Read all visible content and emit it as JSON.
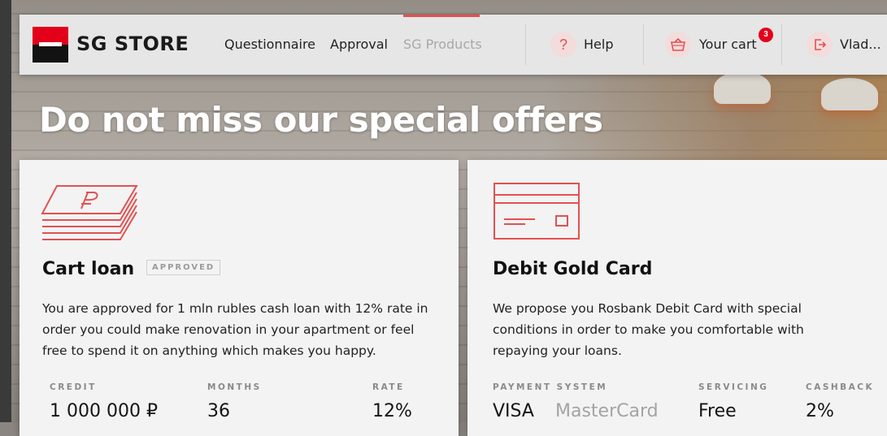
{
  "header": {
    "brand": "SG STORE",
    "nav": [
      "Questionnaire",
      "Approval",
      "SG Products"
    ],
    "active_nav": "SG Products",
    "help_label": "Help",
    "cart_label": "Your cart",
    "cart_count": "3",
    "user_label": "Vlad...",
    "accent_color": "#e35050",
    "brand_red": "#e3001b"
  },
  "headline": "Do not miss our special offers",
  "offers": [
    {
      "icon": "cash-stack-icon",
      "title": "Cart loan",
      "status": "APPROVED",
      "description_lines": [
        "You are approved for 1 mln rubles cash loan with 12% rate in",
        "order you could make renovation in your apartment or feel",
        "free to spend it on anything which makes you happy."
      ],
      "stats": [
        {
          "label": "CREDIT",
          "value": "1 000 000 ₽"
        },
        {
          "label": "MONTHS",
          "value": "36"
        },
        {
          "label": "RATE",
          "value": "12%"
        }
      ]
    },
    {
      "icon": "bank-card-icon",
      "title": "Debit Gold Card",
      "description_lines": [
        "We propose you Rosbank Debit Card with special",
        "conditions in order to make you comfortable with",
        "repaying your loans."
      ],
      "stats": [
        {
          "label": "PAYMENT SYSTEM",
          "value": "VISA",
          "alt_value": "MasterCard"
        },
        {
          "label": "SERVICING",
          "value": "Free"
        },
        {
          "label": "CASHBACK",
          "value": "2%"
        }
      ]
    }
  ]
}
